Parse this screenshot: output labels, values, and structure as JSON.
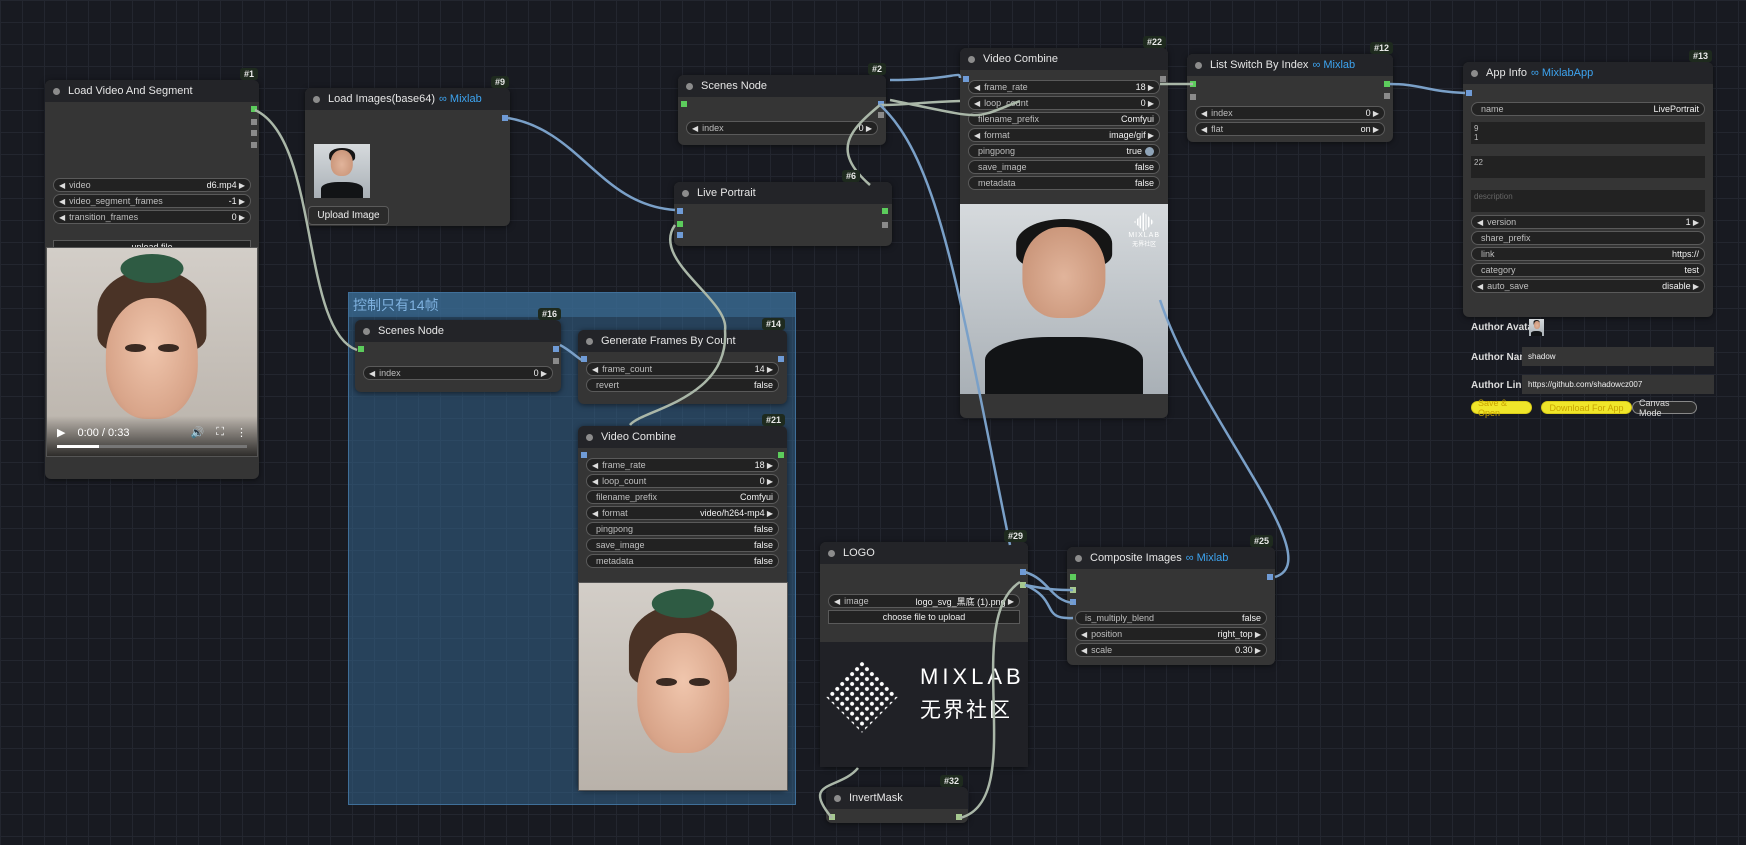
{
  "group": {
    "title": "控制只有14帧"
  },
  "nodes": {
    "load_video": {
      "id": "#1",
      "title": "Load Video And Segment",
      "widgets": [
        {
          "label": "video",
          "value": "d6.mp4"
        },
        {
          "label": "video_segment_frames",
          "value": "-1"
        },
        {
          "label": "transition_frames",
          "value": "0"
        }
      ],
      "upload_label": "upload file",
      "player": {
        "time": "0:00 / 0:33",
        "progress": 0.22
      }
    },
    "load_images": {
      "id": "#9",
      "title": "Load Images(base64)",
      "brand": "∞ Mixlab",
      "upload_label": "Upload Image"
    },
    "scenes_2": {
      "id": "#2",
      "title": "Scenes Node",
      "widgets": [
        {
          "label": "index",
          "value": "0"
        }
      ]
    },
    "live_portrait": {
      "id": "#6",
      "title": "Live Portrait"
    },
    "scenes_16": {
      "id": "#16",
      "title": "Scenes Node",
      "widgets": [
        {
          "label": "index",
          "value": "0"
        }
      ]
    },
    "gen_frames": {
      "id": "#14",
      "title": "Generate Frames By Count",
      "widgets": [
        {
          "label": "frame_count",
          "value": "14"
        },
        {
          "label": "revert",
          "value": "false"
        }
      ]
    },
    "video_combine_21": {
      "id": "#21",
      "title": "Video Combine",
      "widgets": [
        {
          "label": "frame_rate",
          "value": "18"
        },
        {
          "label": "loop_count",
          "value": "0"
        },
        {
          "label": "filename_prefix",
          "value": "Comfyui"
        },
        {
          "label": "format",
          "value": "video/h264-mp4"
        },
        {
          "label": "pingpong",
          "value": "false"
        },
        {
          "label": "save_image",
          "value": "false"
        },
        {
          "label": "metadata",
          "value": "false"
        }
      ]
    },
    "video_combine_22": {
      "id": "#22",
      "title": "Video Combine",
      "widgets": [
        {
          "label": "frame_rate",
          "value": "18"
        },
        {
          "label": "loop_count",
          "value": "0"
        },
        {
          "label": "filename_prefix",
          "value": "Comfyui"
        },
        {
          "label": "format",
          "value": "image/gif"
        },
        {
          "label": "pingpong",
          "value": "true"
        },
        {
          "label": "save_image",
          "value": "false"
        },
        {
          "label": "metadata",
          "value": "false"
        }
      ],
      "logo_top": "MIXLAB",
      "logo_sub": "无界社区"
    },
    "list_switch": {
      "id": "#12",
      "title": "List Switch By Index",
      "brand": "∞ Mixlab",
      "widgets": [
        {
          "label": "index",
          "value": "0"
        },
        {
          "label": "flat",
          "value": "on"
        }
      ]
    },
    "app_info": {
      "id": "#13",
      "title": "App Info",
      "brand": "∞ MixlabApp",
      "name": {
        "label": "name",
        "value": "LivePortrait"
      },
      "text1": "9\n1",
      "text2": "22",
      "text3": "description",
      "widgets": [
        {
          "label": "version",
          "value": "1"
        },
        {
          "label": "share_prefix",
          "value": ""
        },
        {
          "label": "link",
          "value": "https://"
        },
        {
          "label": "category",
          "value": "test"
        },
        {
          "label": "auto_save",
          "value": "disable"
        }
      ],
      "author_avatar_label": "Author Avatar",
      "author_name_label": "Author Name",
      "author_name_value": "shadow",
      "author_link_label": "Author Link",
      "author_link_value": "https://github.com/shadowcz007",
      "buttons": {
        "save_open": "Save & Open",
        "download": "Download For App",
        "canvas": "Canvas Mode"
      }
    },
    "logo": {
      "id": "#29",
      "title": "LOGO",
      "widgets": [
        {
          "label": "image",
          "value": "logo_svg_黑底 (1).png"
        }
      ],
      "choose_label": "choose file to upload",
      "logo_text": "MIXLAB",
      "logo_sub": "无界社区"
    },
    "composite": {
      "id": "#25",
      "title": "Composite Images",
      "brand": "∞ Mixlab",
      "widgets": [
        {
          "label": "is_multiply_blend",
          "value": "false"
        },
        {
          "label": "position",
          "value": "right_top"
        },
        {
          "label": "scale",
          "value": "0.30"
        }
      ]
    },
    "invert_mask": {
      "id": "#32",
      "title": "InvertMask"
    }
  },
  "colors": {
    "accent": "#3da4f0",
    "link_blue": "#6f9bd6",
    "link_grey": "#9fb0a0",
    "yellow_btn": "#f0e62a"
  }
}
